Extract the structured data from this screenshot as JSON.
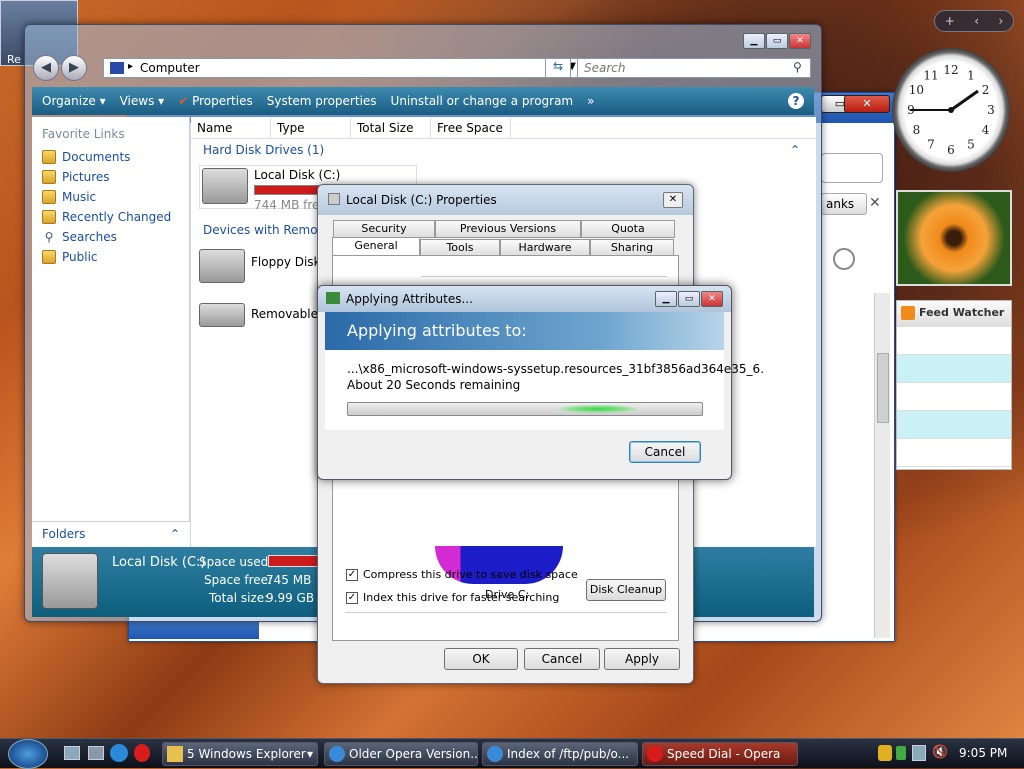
{
  "explorer": {
    "address": "Computer",
    "search_placeholder": "Search",
    "toolbar": [
      "Organize",
      "Views",
      "Properties",
      "System properties",
      "Uninstall or change a program",
      "»"
    ],
    "favorite_links_title": "Favorite Links",
    "favorite_links": [
      "Documents",
      "Pictures",
      "Music",
      "Recently Changed",
      "Searches",
      "Public"
    ],
    "folders_label": "Folders",
    "columns": [
      "Name",
      "Type",
      "Total Size",
      "Free Space"
    ],
    "group_hdd": "Hard Disk Drives (1)",
    "group_devices": "Devices with Removal",
    "drive_c_name": "Local Disk (C:)",
    "drive_c_free": "744 MB free",
    "floppy": "Floppy Disk",
    "removable": "Removable I",
    "details": {
      "name": "Local Disk (C:)",
      "used_label": "Space used:",
      "free_label": "Space free:",
      "free_value": "745 MB",
      "total_label": "Total size:",
      "total_value": "9.99 GB"
    }
  },
  "properties": {
    "title": "Local Disk (C:) Properties",
    "tabs_top": [
      "Security",
      "Previous Versions",
      "Quota"
    ],
    "tabs_bottom": [
      "General",
      "Tools",
      "Hardware",
      "Sharing"
    ],
    "drive_label": "Drive C:",
    "disk_cleanup": "Disk Cleanup",
    "compress": "Compress this drive to save disk space",
    "index": "Index this drive for faster searching",
    "ok": "OK",
    "cancel": "Cancel",
    "apply": "Apply"
  },
  "applying": {
    "title": "Applying Attributes...",
    "banner": "Applying attributes to:",
    "path": "...\\x86_microsoft-windows-syssetup.resources_31bf3856ad364e35_6.",
    "remaining": "About 20 Seconds remaining",
    "cancel": "Cancel"
  },
  "opera": {
    "partial_button": "anks",
    "close_x": "✕"
  },
  "gadgets": {
    "feed_title": "Feed Watcher",
    "sidebar_plus": "+",
    "clock_numbers": [
      "12",
      "1",
      "2",
      "3",
      "4",
      "5",
      "6",
      "7",
      "8",
      "9",
      "10",
      "11"
    ]
  },
  "taskbar": {
    "items": [
      "5 Windows Explorer",
      "Older Opera Version...",
      "Index of /ftp/pub/o...",
      "Speed Dial - Opera"
    ],
    "time": "9:05 PM"
  },
  "desktop": {
    "recycle_label": "Re"
  }
}
